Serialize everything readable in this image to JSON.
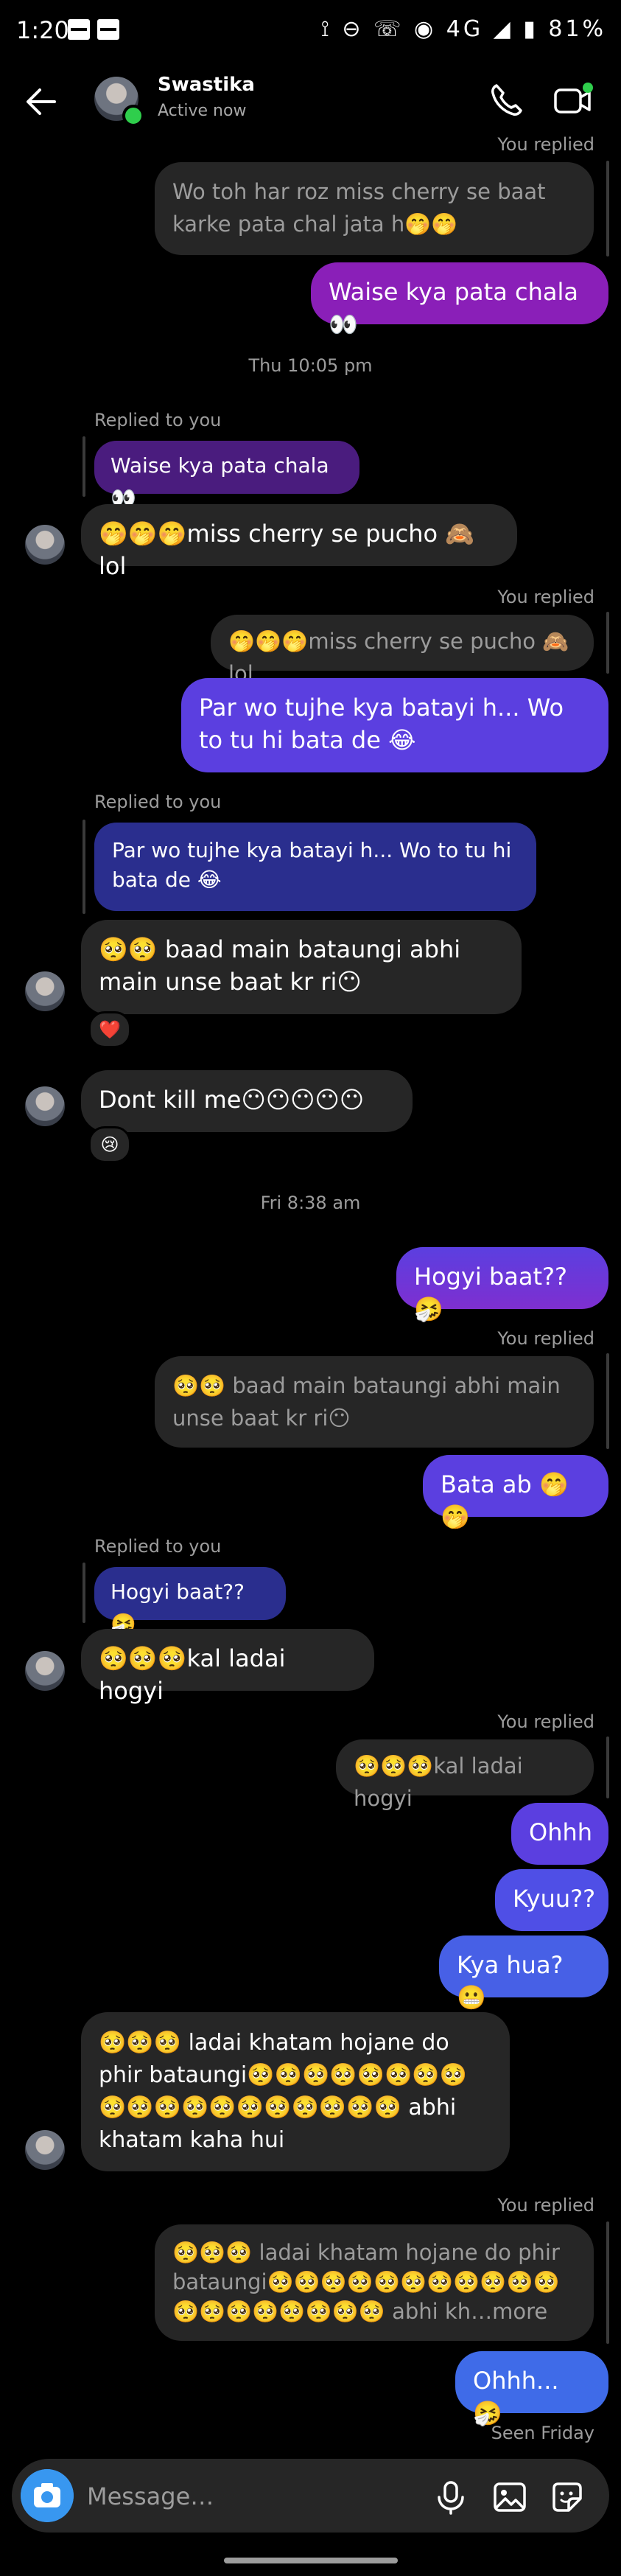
{
  "status": {
    "time": "1:20",
    "icons": "⟟ ⊖ ☏ ◉ 4G ◢ ▮",
    "battery": "81%"
  },
  "header": {
    "name": "Swastika",
    "status": "Active now"
  },
  "messages": {
    "m1_label": "You replied",
    "m1_quote": "Wo toh har roz miss cherry se baat karke pata chal jata h🤭🤭",
    "m1_text": "Waise kya pata chala 👀",
    "ts1": "Thu 10:05 pm",
    "m2_label": "Replied to you",
    "m2_quote": "Waise kya pata chala 👀",
    "m2_text": "🤭🤭🤭miss cherry se pucho 🙈 lol",
    "m3_label": "You replied",
    "m3_quote": "🤭🤭🤭miss cherry se pucho 🙈 lol",
    "m3_text": "Par wo tujhe kya batayi h... Wo to tu hi bata de 😂",
    "m4_label": "Replied to you",
    "m4_quote": "Par wo tujhe kya batayi h... Wo to tu hi bata de 😂",
    "m4_text": "🥺🥺 baad main bataungi abhi main unse baat kr ri😶",
    "m4_reaction": "❤️",
    "m5_text": "Dont kill me😶😶😶😶😶",
    "m5_reaction": "😢",
    "ts2": "Fri 8:38 am",
    "m6_text": "Hogyi baat?? 🤧",
    "m7_label": "You replied",
    "m7_quote": "🥺🥺 baad main bataungi abhi main unse baat kr ri😶",
    "m7_text": "Bata ab 🤭🤭",
    "m8_label": "Replied to you",
    "m8_quote": "Hogyi baat?? 🤧",
    "m8_text": "🥺🥺🥺kal ladai hogyi",
    "m9_label": "You replied",
    "m9_quote": "🥺🥺🥺kal ladai hogyi",
    "m10_text": "Ohhh",
    "m11_text": "Kyuu??",
    "m12_text": "Kya hua? 😬",
    "m13_text": "🥺🥺🥺 ladai khatam hojane do phir bataungi🥺🥺🥺🥺🥺🥺🥺🥺🥺🥺🥺🥺🥺🥺🥺🥺🥺🥺🥺 abhi khatam kaha hui",
    "m14_label": "You replied",
    "m14_quote": "🥺🥺🥺 ladai khatam hojane do phir bataungi🥺🥺🥺🥺🥺🥺🥺🥺🥺🥺🥺🥺🥺🥺🥺🥺🥺🥺🥺 abhi kh…more",
    "m14_text": "Ohhh... 🤧",
    "seen": "Seen Friday"
  },
  "composer": {
    "placeholder": "Message…"
  },
  "colors": {
    "purple": "#8a1fb8",
    "violet": "#5b3fe0",
    "blue": "#3f6be8",
    "grey": "#262626"
  }
}
